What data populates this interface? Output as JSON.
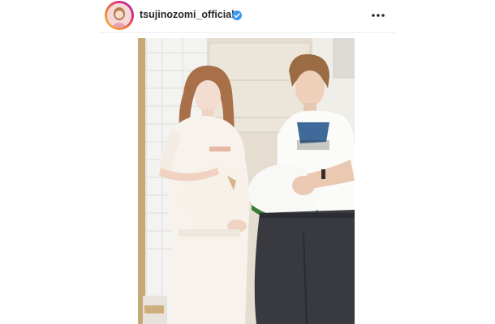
{
  "post": {
    "username": "tsujinozomi_official",
    "verified_icon": "verified-badge-icon",
    "more_icon": "more-options-icon",
    "photo_subject": "couple-maternity-photo",
    "colors": {
      "verified": "#3897f0",
      "username": "#262626",
      "avatar_gradient": [
        "#f9c24a",
        "#dd2a7b",
        "#9b2fb8"
      ]
    }
  }
}
